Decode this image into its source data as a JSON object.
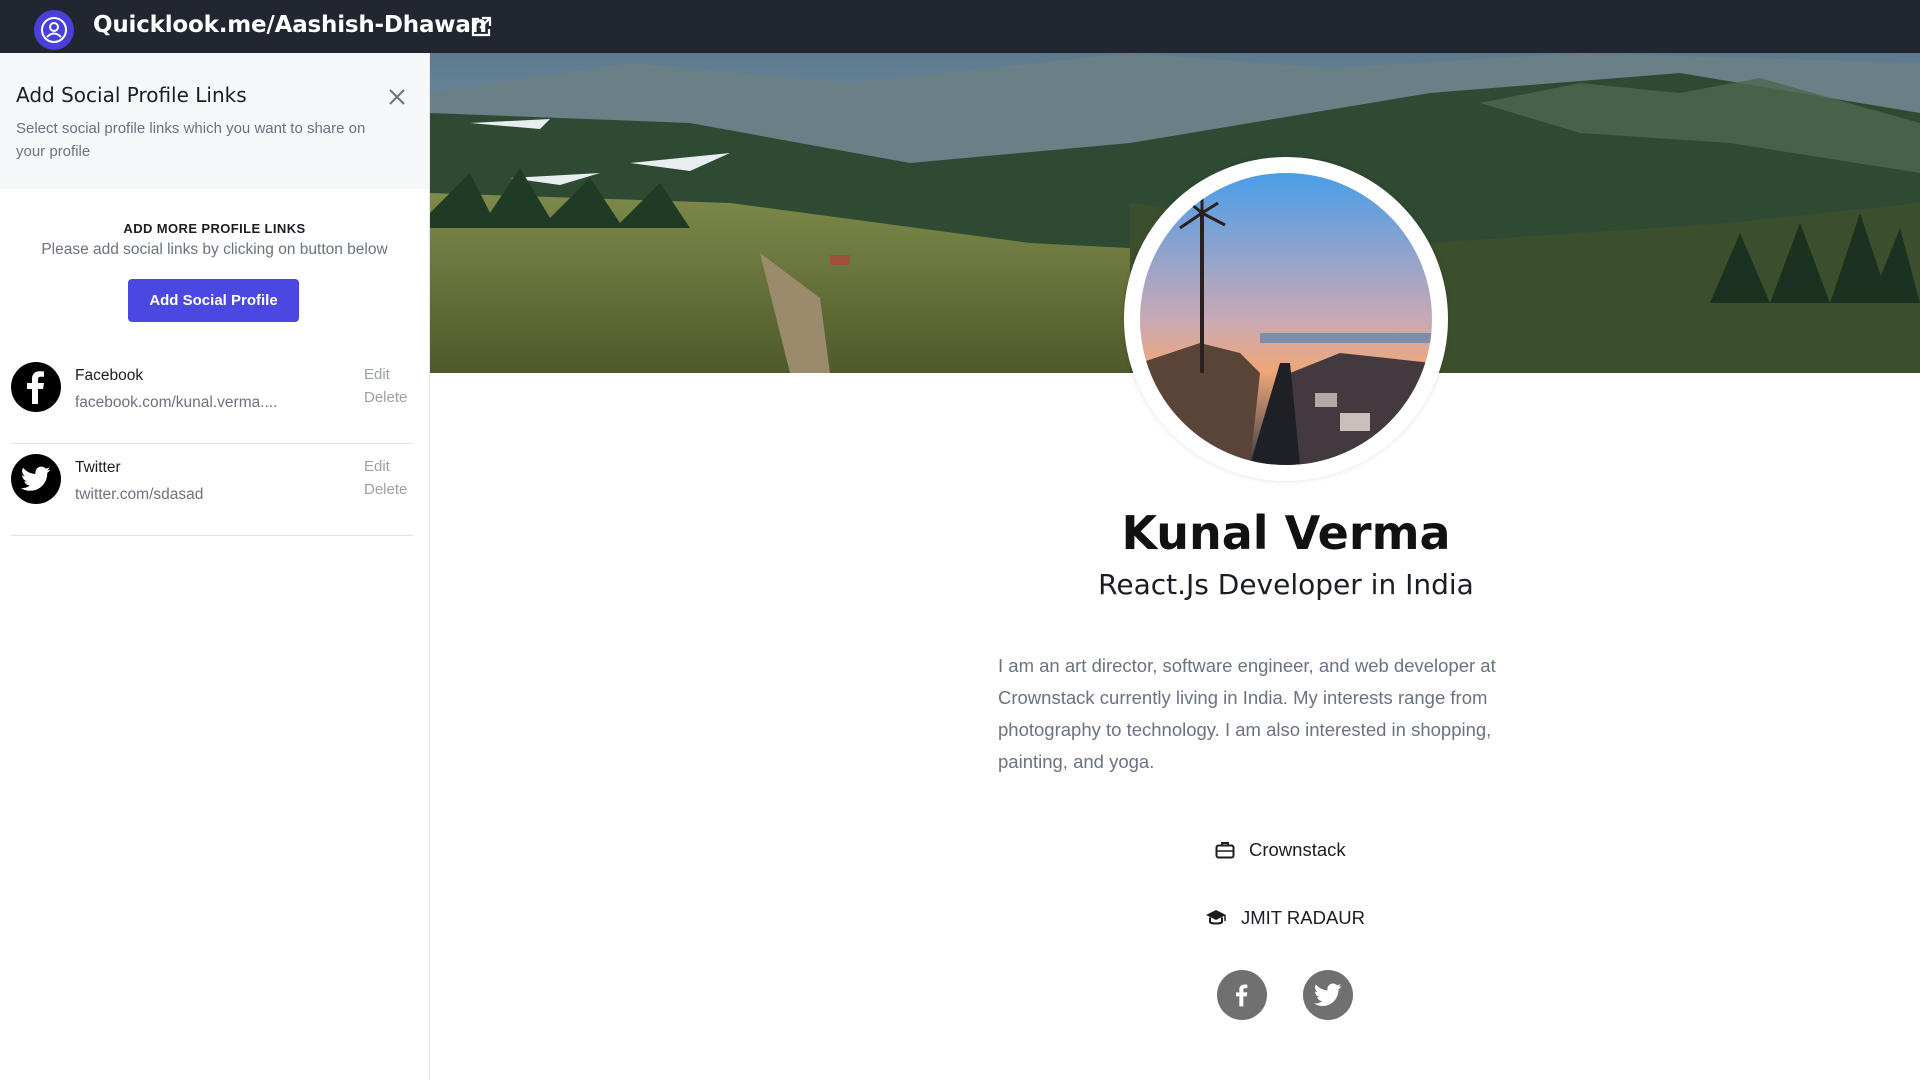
{
  "header": {
    "url_text": "Quicklook.me/Aashish-Dhawan",
    "logo_icon": "user-circle-icon",
    "external_icon": "external-link-icon",
    "bar_color": "#212631",
    "logo_color": "#4a3fd8"
  },
  "sidebar": {
    "title": "Add Social Profile Links",
    "subtitle": "Select social profile links which you want to share on your profile",
    "close_icon": "close-icon",
    "add_more_title": "ADD MORE PROFILE LINKS",
    "add_more_subtitle": "Please add social links by clicking on button below",
    "add_button_label": "Add Social Profile",
    "add_button_color": "#4a48e0",
    "links": [
      {
        "name": "Facebook",
        "url": "facebook.com/kunal.verma....",
        "icon": "facebook-icon",
        "edit_label": "Edit",
        "delete_label": "Delete"
      },
      {
        "name": "Twitter",
        "url": "twitter.com/sdasad",
        "icon": "twitter-icon",
        "edit_label": "Edit",
        "delete_label": "Delete"
      }
    ]
  },
  "profile": {
    "name": "Kunal Verma",
    "role": "React.Js Developer in India",
    "bio": "I am an art director, software engineer, and web developer at Crownstack currently living in India. My interests range from photography to technology. I am also interested in shopping, painting, and yoga.",
    "company": "Crownstack",
    "company_icon": "briefcase-icon",
    "education": "JMIT RADAUR",
    "education_icon": "graduation-cap-icon",
    "social_icons": [
      "facebook-icon",
      "twitter-icon"
    ]
  }
}
